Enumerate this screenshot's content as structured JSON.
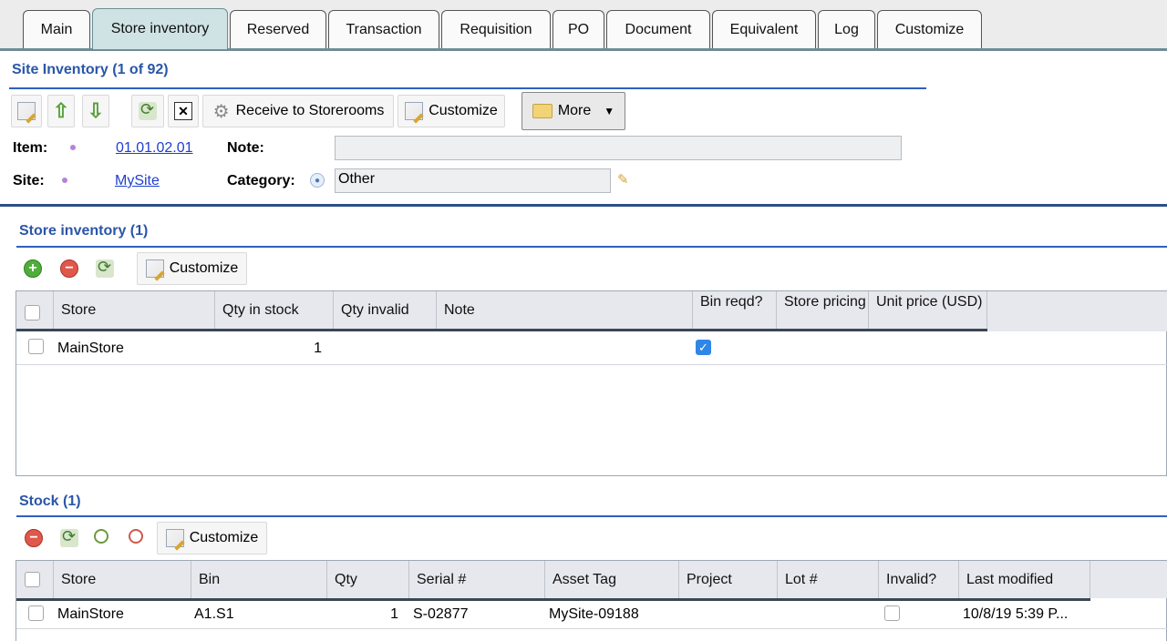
{
  "tabs": [
    {
      "label": "Main"
    },
    {
      "label": "Store inventory"
    },
    {
      "label": "Reserved"
    },
    {
      "label": "Transaction"
    },
    {
      "label": "Requisition"
    },
    {
      "label": "PO"
    },
    {
      "label": "Document"
    },
    {
      "label": "Equivalent"
    },
    {
      "label": "Log"
    },
    {
      "label": "Customize"
    }
  ],
  "site_inventory": {
    "title": "Site Inventory (1 of 92)",
    "toolbar": {
      "receive_label": "Receive to Storerooms",
      "customize_label": "Customize",
      "more_label": "More",
      "icons": [
        "edit-icon",
        "arrow-up-icon",
        "arrow-down-icon",
        "refresh-icon",
        "close-icon",
        "gear-icon",
        "customize-icon",
        "folder-icon",
        "caret-down-icon"
      ]
    },
    "item_label": "Item:",
    "item_value": "01.01.02.01",
    "note_label": "Note:",
    "note_value": "",
    "site_label": "Site:",
    "site_value": "MySite",
    "category_label": "Category:",
    "category_value": "Other"
  },
  "store_inventory": {
    "title": "Store inventory (1)",
    "customize_label": "Customize",
    "columns": [
      "Store",
      "Qty in stock",
      "Qty invalid",
      "Note",
      "Bin reqd?",
      "Store pricing",
      "Unit price (USD)"
    ],
    "rows": [
      {
        "store": "MainStore",
        "qty_in_stock": "1",
        "qty_invalid": "",
        "note": "",
        "bin_reqd": true,
        "store_pricing": "",
        "unit_price": ""
      }
    ]
  },
  "stock": {
    "title": "Stock (1)",
    "customize_label": "Customize",
    "columns": [
      "Store",
      "Bin",
      "Qty",
      "Serial #",
      "Asset Tag",
      "Project",
      "Lot #",
      "Invalid?",
      "Last modified"
    ],
    "rows": [
      {
        "store": "MainStore",
        "bin": "A1.S1",
        "qty": "1",
        "serial": "S-02877",
        "asset_tag": "MySite-09188",
        "project": "",
        "lot": "",
        "invalid": false,
        "last_modified": "10/8/19 5:39 P..."
      }
    ]
  },
  "colors": {
    "accent": "#2a56a8",
    "active_tab": "#cfe3e5",
    "link": "#1f3fd1",
    "checkbox_on": "#2f86e6"
  }
}
